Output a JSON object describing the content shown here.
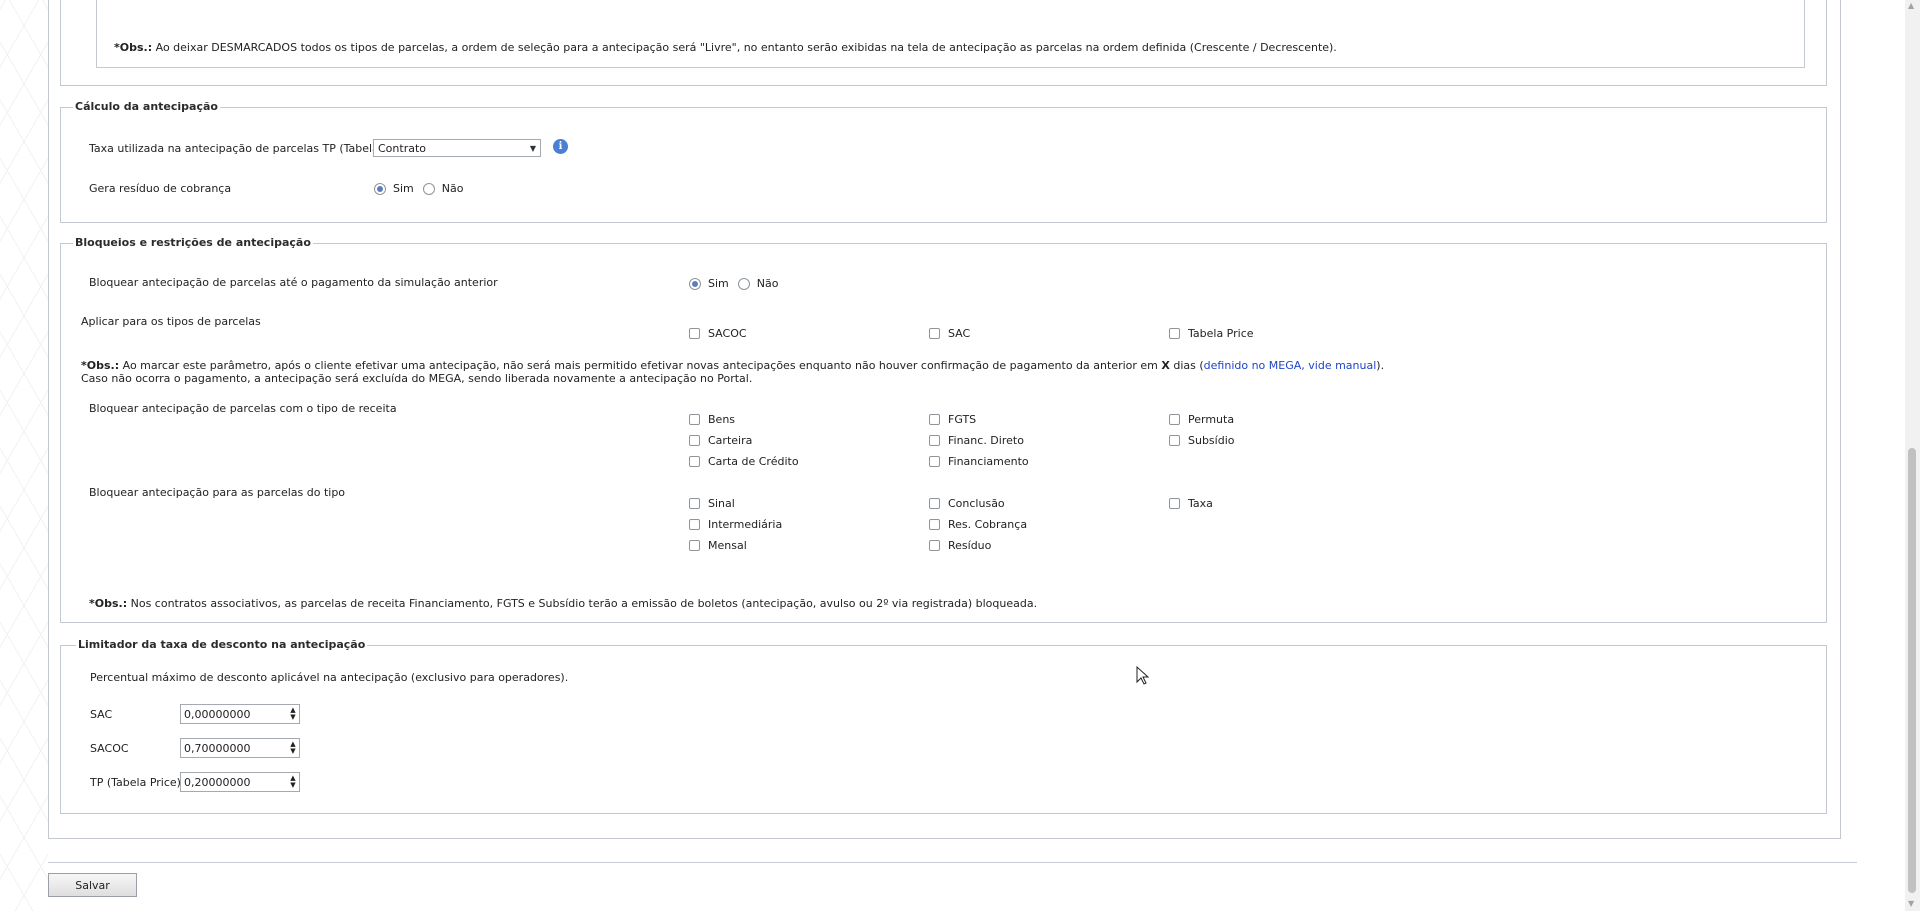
{
  "top_obs": {
    "prefix": "*Obs.:",
    "text": " Ao deixar DESMARCADOS todos os tipos de parcelas, a ordem de seleção para a antecipação será \"Livre\", no entanto serão exibidas na tela de antecipação as parcelas na ordem definida (Crescente / Decrescente)."
  },
  "calc": {
    "legend": "Cálculo da antecipação",
    "taxa_label": "Taxa utilizada na antecipação de parcelas TP (Tabela Price)",
    "taxa_value": "Contrato",
    "residuo_label": "Gera resíduo de cobrança",
    "sim": "Sim",
    "nao": "Não",
    "residuo_selected": "Sim"
  },
  "bloqueios": {
    "legend": "Bloqueios e restrições de antecipação",
    "bloquear_sim_label": "Bloquear antecipação de parcelas até o pagamento da simulação anterior",
    "sim": "Sim",
    "nao": "Não",
    "bloquear_selected": "Sim",
    "aplicar_label": "Aplicar para os tipos de parcelas",
    "aplicar_options": [
      "SACOC",
      "SAC",
      "Tabela Price"
    ],
    "obs1_prefix": "*Obs.:",
    "obs1_a": " Ao marcar este parâmetro, após o cliente efetivar uma antecipação, não será mais permitido efetivar novas antecipações enquanto não houver confirmação de pagamento da anterior em ",
    "obs1_x": "X",
    "obs1_b": " dias (",
    "obs1_link": "definido no MEGA, vide manual",
    "obs1_c": ").",
    "obs1_line2": "Caso não ocorra o pagamento, a antecipação será excluída do MEGA, sendo liberada novamente a antecipação no Portal.",
    "receita_label": "Bloquear antecipação de parcelas com o tipo de receita",
    "receita_options": [
      "Bens",
      "FGTS",
      "Permuta",
      "Carteira",
      "Financ. Direto",
      "Subsídio",
      "Carta de Crédito",
      "Financiamento"
    ],
    "tipo_label": "Bloquear antecipação para as parcelas do tipo",
    "tipo_options": [
      "Sinal",
      "Conclusão",
      "Taxa",
      "Intermediária",
      "Res. Cobrança",
      "Mensal",
      "Resíduo"
    ],
    "obs2_prefix": "*Obs.:",
    "obs2_text": " Nos contratos associativos, as parcelas de receita Financiamento, FGTS e Subsídio terão a emissão de boletos (antecipação, avulso ou 2º via registrada) bloqueada."
  },
  "limitador": {
    "legend": "Limitador da taxa de desconto na antecipação",
    "desc": "Percentual máximo de desconto aplicável na antecipação (exclusivo para operadores).",
    "fields": [
      {
        "label": "SAC",
        "value": "0,00000000"
      },
      {
        "label": "SACOC",
        "value": "0,70000000"
      },
      {
        "label": "TP (Tabela Price)",
        "value": "0,20000000"
      }
    ]
  },
  "save_label": "Salvar",
  "icons": {
    "info": "info-icon",
    "select_arrow": "triangle-down",
    "spinner": "up-down-arrows"
  },
  "colors": {
    "link": "#1f44c8",
    "radio_dot": "#5b7dbf",
    "border": "#c4c9cf"
  }
}
